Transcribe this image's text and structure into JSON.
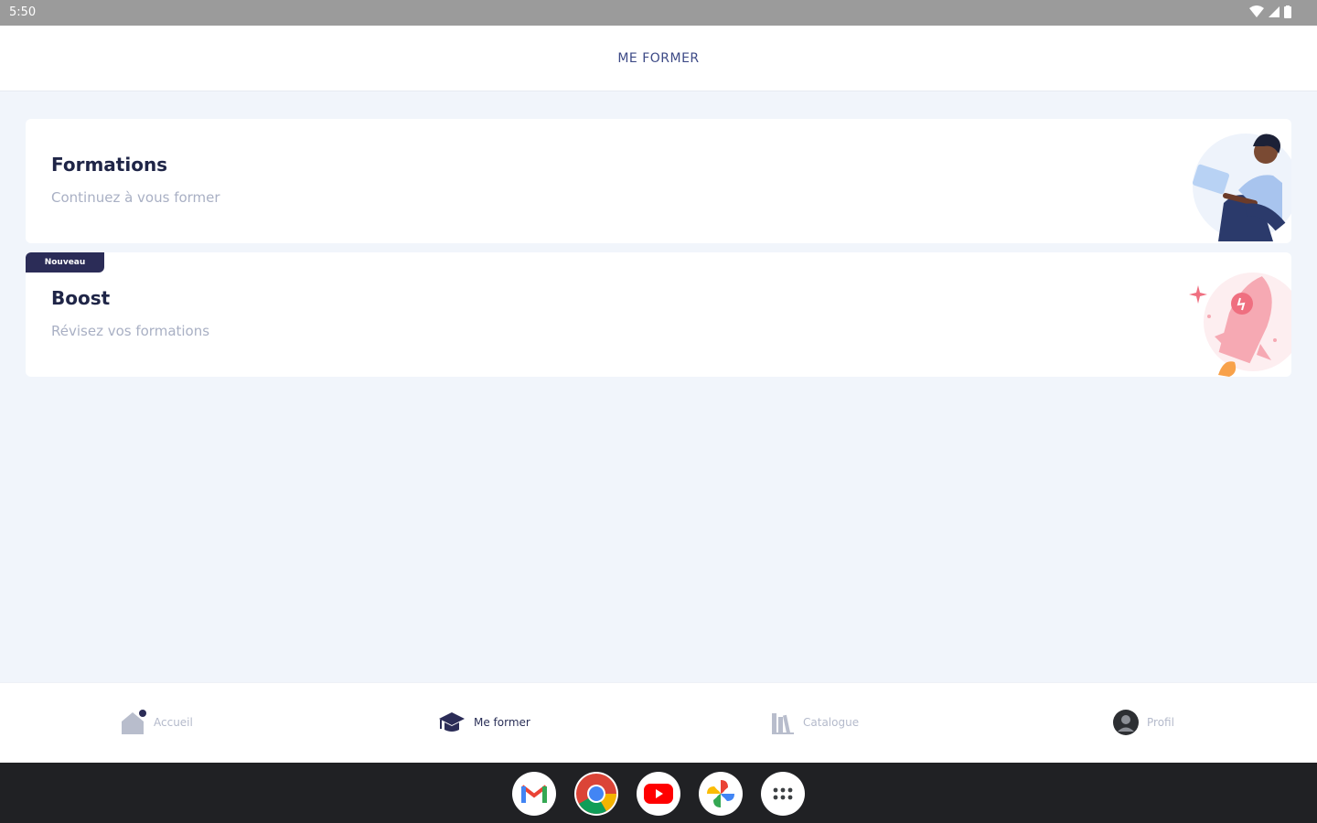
{
  "status_bar": {
    "time": "5:50"
  },
  "header": {
    "title": "ME FORMER"
  },
  "cards": [
    {
      "title": "Formations",
      "subtitle": "Continuez à vous former"
    },
    {
      "badge": "Nouveau",
      "title": "Boost",
      "subtitle": "Révisez vos formations"
    }
  ],
  "bottom_nav": {
    "items": [
      {
        "label": "Accueil",
        "icon": "home-icon",
        "active": false
      },
      {
        "label": "Me former",
        "icon": "graduation-cap-icon",
        "active": true
      },
      {
        "label": "Catalogue",
        "icon": "library-icon",
        "active": false
      },
      {
        "label": "Profil",
        "icon": "avatar-icon",
        "active": false
      }
    ]
  },
  "dock": {
    "apps": [
      "gmail-icon",
      "chrome-icon",
      "youtube-icon",
      "photos-icon",
      "app-drawer-icon"
    ]
  },
  "colors": {
    "accent": "#2b2c57",
    "muted": "#a9b0c4",
    "background": "#f1f5fb"
  }
}
